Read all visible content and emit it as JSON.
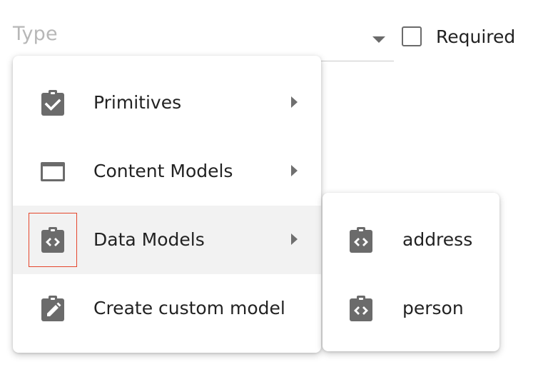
{
  "field": {
    "type_placeholder": "Type",
    "required_label": "Required",
    "required_checked": false
  },
  "menu": {
    "items": [
      {
        "label": "Primitives",
        "icon": "clipboard-check-icon",
        "has_submenu": true,
        "active": false
      },
      {
        "label": "Content Models",
        "icon": "window-icon",
        "has_submenu": true,
        "active": false
      },
      {
        "label": "Data Models",
        "icon": "clipboard-code-icon",
        "has_submenu": true,
        "active": true
      },
      {
        "label": "Create custom model",
        "icon": "clipboard-edit-icon",
        "has_submenu": false,
        "active": false
      }
    ]
  },
  "submenu": {
    "items": [
      {
        "label": "address",
        "icon": "clipboard-code-icon"
      },
      {
        "label": "person",
        "icon": "clipboard-code-icon"
      }
    ]
  },
  "colors": {
    "icon": "#6b6b6b",
    "active_row": "#f2f2f2",
    "highlight": "#e5462c",
    "placeholder": "#b7b7b7"
  }
}
